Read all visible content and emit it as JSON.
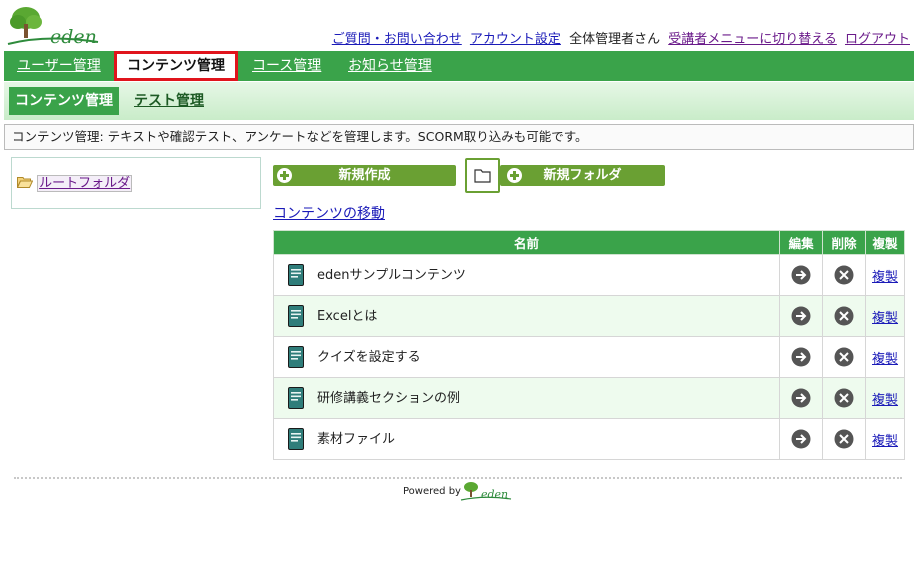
{
  "brand": {
    "logo_text": "eden",
    "accent": "#3aa34a",
    "active_border": "#e0141c"
  },
  "toplinks": {
    "contact": "ご質問・お問い合わせ",
    "account": "アカウント設定",
    "user": "全体管理者さん",
    "switch_menu": "受講者メニューに切り替える",
    "logout": "ログアウト"
  },
  "mainnav": [
    "ユーザー管理",
    "コンテンツ管理",
    "コース管理",
    "お知らせ管理"
  ],
  "subnav": [
    "コンテンツ管理",
    "テスト管理"
  ],
  "description": "コンテンツ管理: テキストや確認テスト、アンケートなどを管理します。SCORM取り込みも可能です。",
  "tree": {
    "root_label": "ルートフォルダ",
    "icon": "folder-open-icon"
  },
  "buttons": {
    "new_create": "新規作成",
    "new_folder": "新規フォルダ"
  },
  "move_link": "コンテンツの移動",
  "table": {
    "headers": [
      "名前",
      "編集",
      "削除",
      "複製"
    ],
    "copy_label": "複製",
    "rows": [
      {
        "name": "edenサンプルコンテンツ"
      },
      {
        "name": "Excelとは"
      },
      {
        "name": "クイズを設定する"
      },
      {
        "name": "研修講義セクションの例"
      },
      {
        "name": "素材ファイル"
      }
    ]
  },
  "footer": {
    "powered_by": "Powered by",
    "logo_text": "eden"
  }
}
